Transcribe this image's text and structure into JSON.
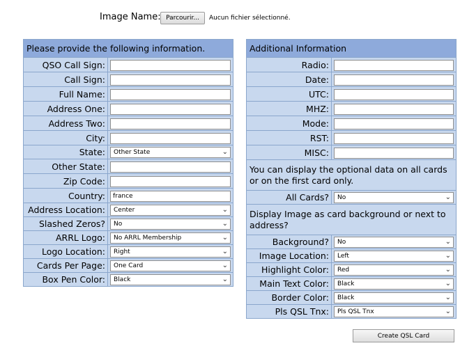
{
  "upload": {
    "label": "Image Name:",
    "browse_label": "Parcourir...",
    "status": "Aucun fichier sélectionné."
  },
  "left_form": {
    "header": "Please provide the following information.",
    "rows": [
      {
        "label": "QSO Call Sign:",
        "type": "text",
        "value": ""
      },
      {
        "label": "Call Sign:",
        "type": "text",
        "value": ""
      },
      {
        "label": "Full Name:",
        "type": "text",
        "value": ""
      },
      {
        "label": "Address One:",
        "type": "text",
        "value": ""
      },
      {
        "label": "Address Two:",
        "type": "text",
        "value": ""
      },
      {
        "label": "City:",
        "type": "text",
        "value": ""
      },
      {
        "label": "State:",
        "type": "select",
        "value": "Other State"
      },
      {
        "label": "Other State:",
        "type": "text",
        "value": ""
      },
      {
        "label": "Zip Code:",
        "type": "text",
        "value": ""
      },
      {
        "label": "Country:",
        "type": "text",
        "value": "france"
      },
      {
        "label": "Address Location:",
        "type": "select",
        "value": "Center"
      },
      {
        "label": "Slashed Zeros?",
        "type": "select",
        "value": "No"
      },
      {
        "label": "ARRL Logo:",
        "type": "select",
        "value": "No ARRL Membership"
      },
      {
        "label": "Logo Location:",
        "type": "select",
        "value": "Right"
      },
      {
        "label": "Cards Per Page:",
        "type": "select",
        "value": "One Card"
      },
      {
        "label": "Box Pen Color:",
        "type": "select",
        "value": "Black"
      }
    ]
  },
  "right_form": {
    "header": "Additional Information",
    "rows": [
      {
        "label": "Radio:",
        "type": "text",
        "value": ""
      },
      {
        "label": "Date:",
        "type": "text",
        "value": ""
      },
      {
        "label": "UTC:",
        "type": "text",
        "value": ""
      },
      {
        "label": "MHZ:",
        "type": "text",
        "value": ""
      },
      {
        "label": "Mode:",
        "type": "text",
        "value": ""
      },
      {
        "label": "RST:",
        "type": "text",
        "value": ""
      },
      {
        "label": "MISC:",
        "type": "text",
        "value": ""
      }
    ],
    "note1": "You can display the optional data on all cards or on the first card only.",
    "all_cards": {
      "label": "All Cards?",
      "type": "select",
      "value": "No"
    },
    "note2": "Display Image as card background or next to address?",
    "rows2": [
      {
        "label": "Background?",
        "type": "select",
        "value": "No"
      },
      {
        "label": "Image Location:",
        "type": "select",
        "value": "Left"
      },
      {
        "label": "Highlight Color:",
        "type": "select",
        "value": "Red"
      },
      {
        "label": "Main Text Color:",
        "type": "select",
        "value": "Black"
      },
      {
        "label": "Border Color:",
        "type": "select",
        "value": "Black"
      },
      {
        "label": "Pls QSL Tnx:",
        "type": "select",
        "value": "Pls QSL Tnx"
      }
    ]
  },
  "create_button": "Create QSL Card",
  "icons": {
    "dropdown": "chevron-down-icon"
  }
}
